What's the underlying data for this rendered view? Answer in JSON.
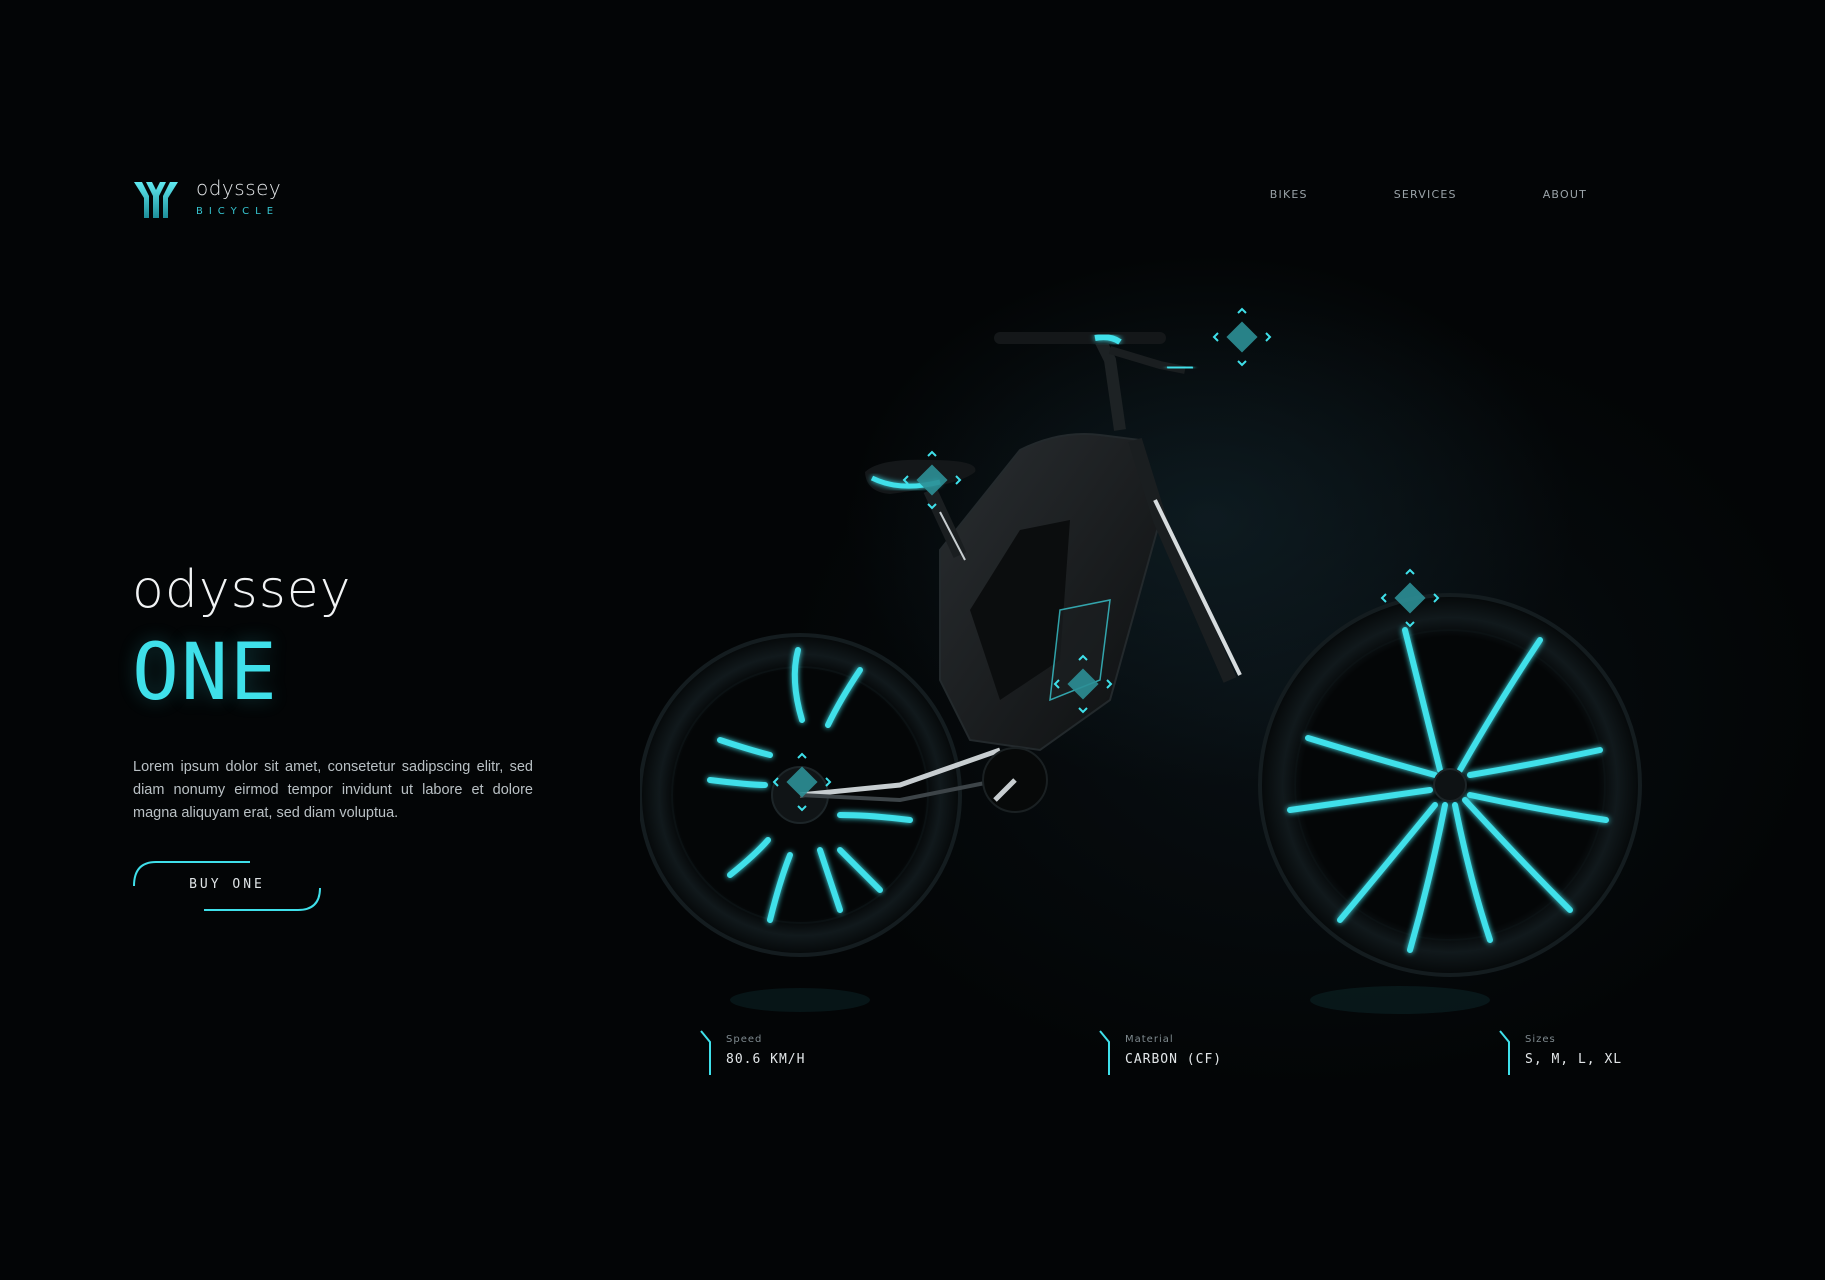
{
  "brand": {
    "name": "odyssey",
    "subtitle": "BICYCLE",
    "logo_icon": "odyssey-logo-icon"
  },
  "nav": {
    "items": [
      {
        "label": "BIKES"
      },
      {
        "label": "SERVICES"
      },
      {
        "label": "ABOUT"
      }
    ]
  },
  "hero": {
    "brand": "odyssey",
    "model": "ONE",
    "description": "Lorem ipsum dolor sit amet, consetetur sadipscing elitr, sed diam nonumy eirmod tempor invidunt ut labore et dolore magna aliquyam erat, sed diam voluptua.",
    "cta_label": "BUY ONE"
  },
  "specs": [
    {
      "label": "Speed",
      "value": "80.6 KM/H"
    },
    {
      "label": "Material",
      "value": "CARBON (CF)"
    },
    {
      "label": "Sizes",
      "value": "S, M, L, XL"
    }
  ],
  "hotspots": [
    {
      "name": "handlebar-hotspot"
    },
    {
      "name": "saddle-hotspot"
    },
    {
      "name": "fork-hotspot"
    },
    {
      "name": "frame-hotspot"
    },
    {
      "name": "rear-hub-hotspot"
    }
  ],
  "colors": {
    "background": "#030506",
    "accent": "#3fe0ea",
    "text": "#d9dde0"
  }
}
